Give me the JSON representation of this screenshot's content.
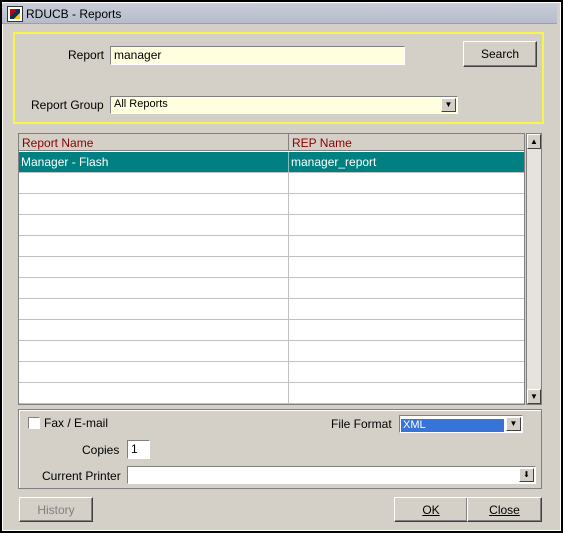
{
  "window": {
    "title": "RDUCB - Reports",
    "app_icon": "app-icon"
  },
  "search": {
    "report_label": "Report",
    "report_value": "manager",
    "search_button": "Search",
    "report_group_label": "Report Group",
    "report_group_value": "All Reports"
  },
  "table": {
    "columns": [
      "Report Name",
      "REP Name"
    ],
    "rows": [
      {
        "report_name": "Manager - Flash",
        "rep_name": "manager_report",
        "selected": true
      }
    ],
    "empty_row_count": 11
  },
  "options": {
    "fax_email_label": "Fax / E-mail",
    "fax_email_checked": false,
    "file_format_label": "File Format",
    "file_format_value": "XML",
    "copies_label": "Copies",
    "copies_value": "1",
    "current_printer_label": "Current Printer",
    "current_printer_value": ""
  },
  "buttons": {
    "history": "History",
    "ok": "OK",
    "close": "Close"
  },
  "colors": {
    "selected_row": "#008080",
    "header_text": "#8b0000",
    "search_panel_border": "#f5f54c",
    "input_bg": "#ffffe0"
  }
}
